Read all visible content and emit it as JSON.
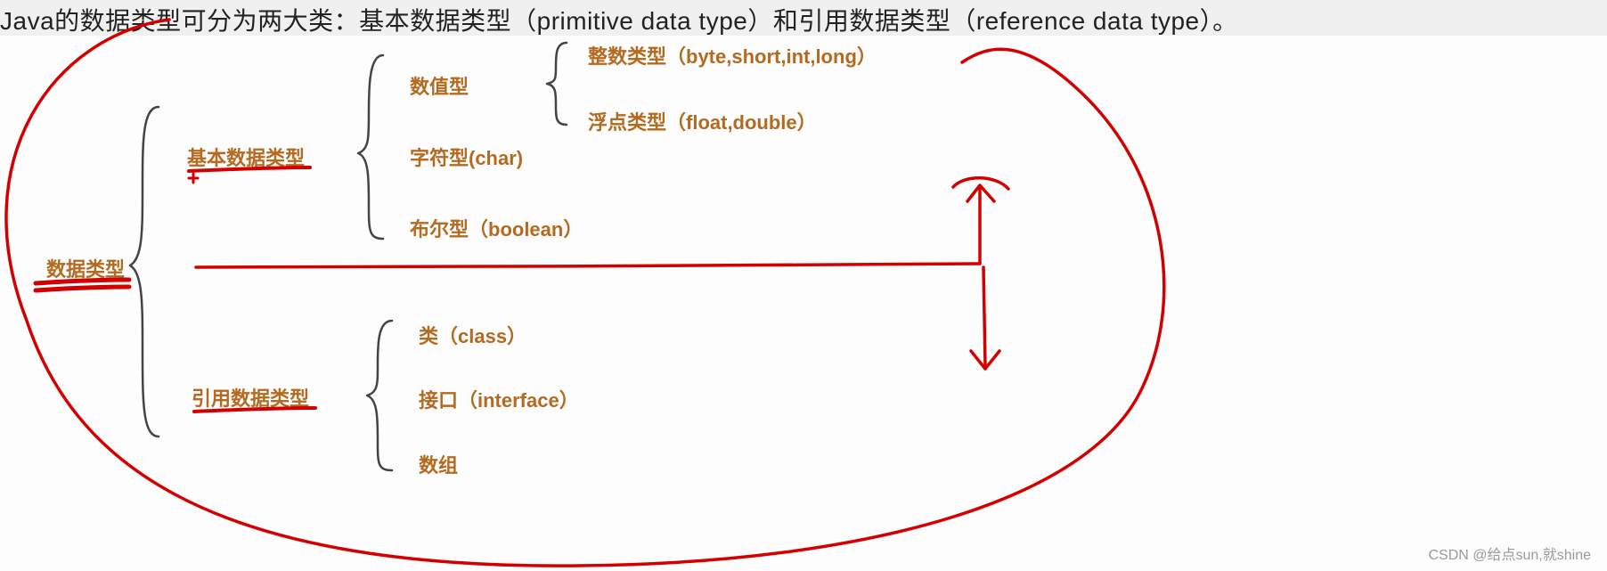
{
  "header": {
    "text": "Java的数据类型可分为两大类：基本数据类型（primitive data type）和引用数据类型（reference data type）。"
  },
  "diagram": {
    "root": "数据类型",
    "branches": {
      "primitive": {
        "label": "基本数据类型",
        "children": {
          "numeric": {
            "label": "数值型",
            "children": {
              "integer": "整数类型（byte,short,int,long）",
              "float": "浮点类型（float,double）"
            }
          },
          "char": "字符型(char)",
          "boolean": "布尔型（boolean）"
        }
      },
      "reference": {
        "label": "引用数据类型",
        "children": {
          "class": "类（class）",
          "interface": "接口（interface）",
          "array": "数组"
        }
      }
    }
  },
  "watermark": "CSDN @给点sun,就shine",
  "colors": {
    "node_text": "#b46a1f",
    "scribble": "#d40000",
    "brace": "#444444"
  }
}
